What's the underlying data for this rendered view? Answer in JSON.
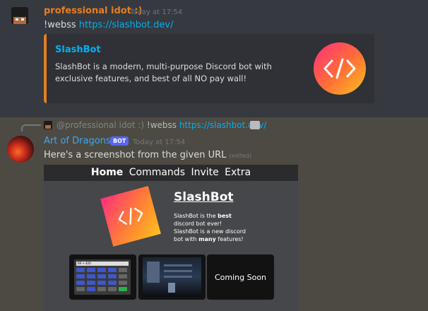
{
  "message1": {
    "author": "professional idot :)",
    "timestamp": "Today at 17:54",
    "content_prefix": "!webss ",
    "content_link": "https://slashbot.dev/",
    "embed": {
      "title": "SlashBot",
      "description": "SlashBot is a modern, multi-purpose Discord bot with exclusive features, and best of all NO pay wall!",
      "thumbnail_glyph": "</>"
    }
  },
  "reply": {
    "mention": "@professional idot :)",
    "command": "!webss ",
    "link": "https://slashbot.dev/"
  },
  "message2": {
    "author": "Art of Dragons",
    "bot_tag": "BOT",
    "timestamp": "Today at 17:54",
    "content": "Here's a screenshot from the given URL",
    "edited": "(edited)",
    "screenshot": {
      "nav": [
        "Home",
        "Commands",
        "Invite",
        "Extra"
      ],
      "title": "SlashBot",
      "logo_glyph": "</>",
      "calc_display": "69 + 420",
      "coming_soon": "Coming Soon"
    }
  },
  "colors": {
    "accent_orange": "#e67e22",
    "link": "#00b0f4",
    "bot_name": "#3fa7f0",
    "bot_tag": "#5865f2"
  }
}
